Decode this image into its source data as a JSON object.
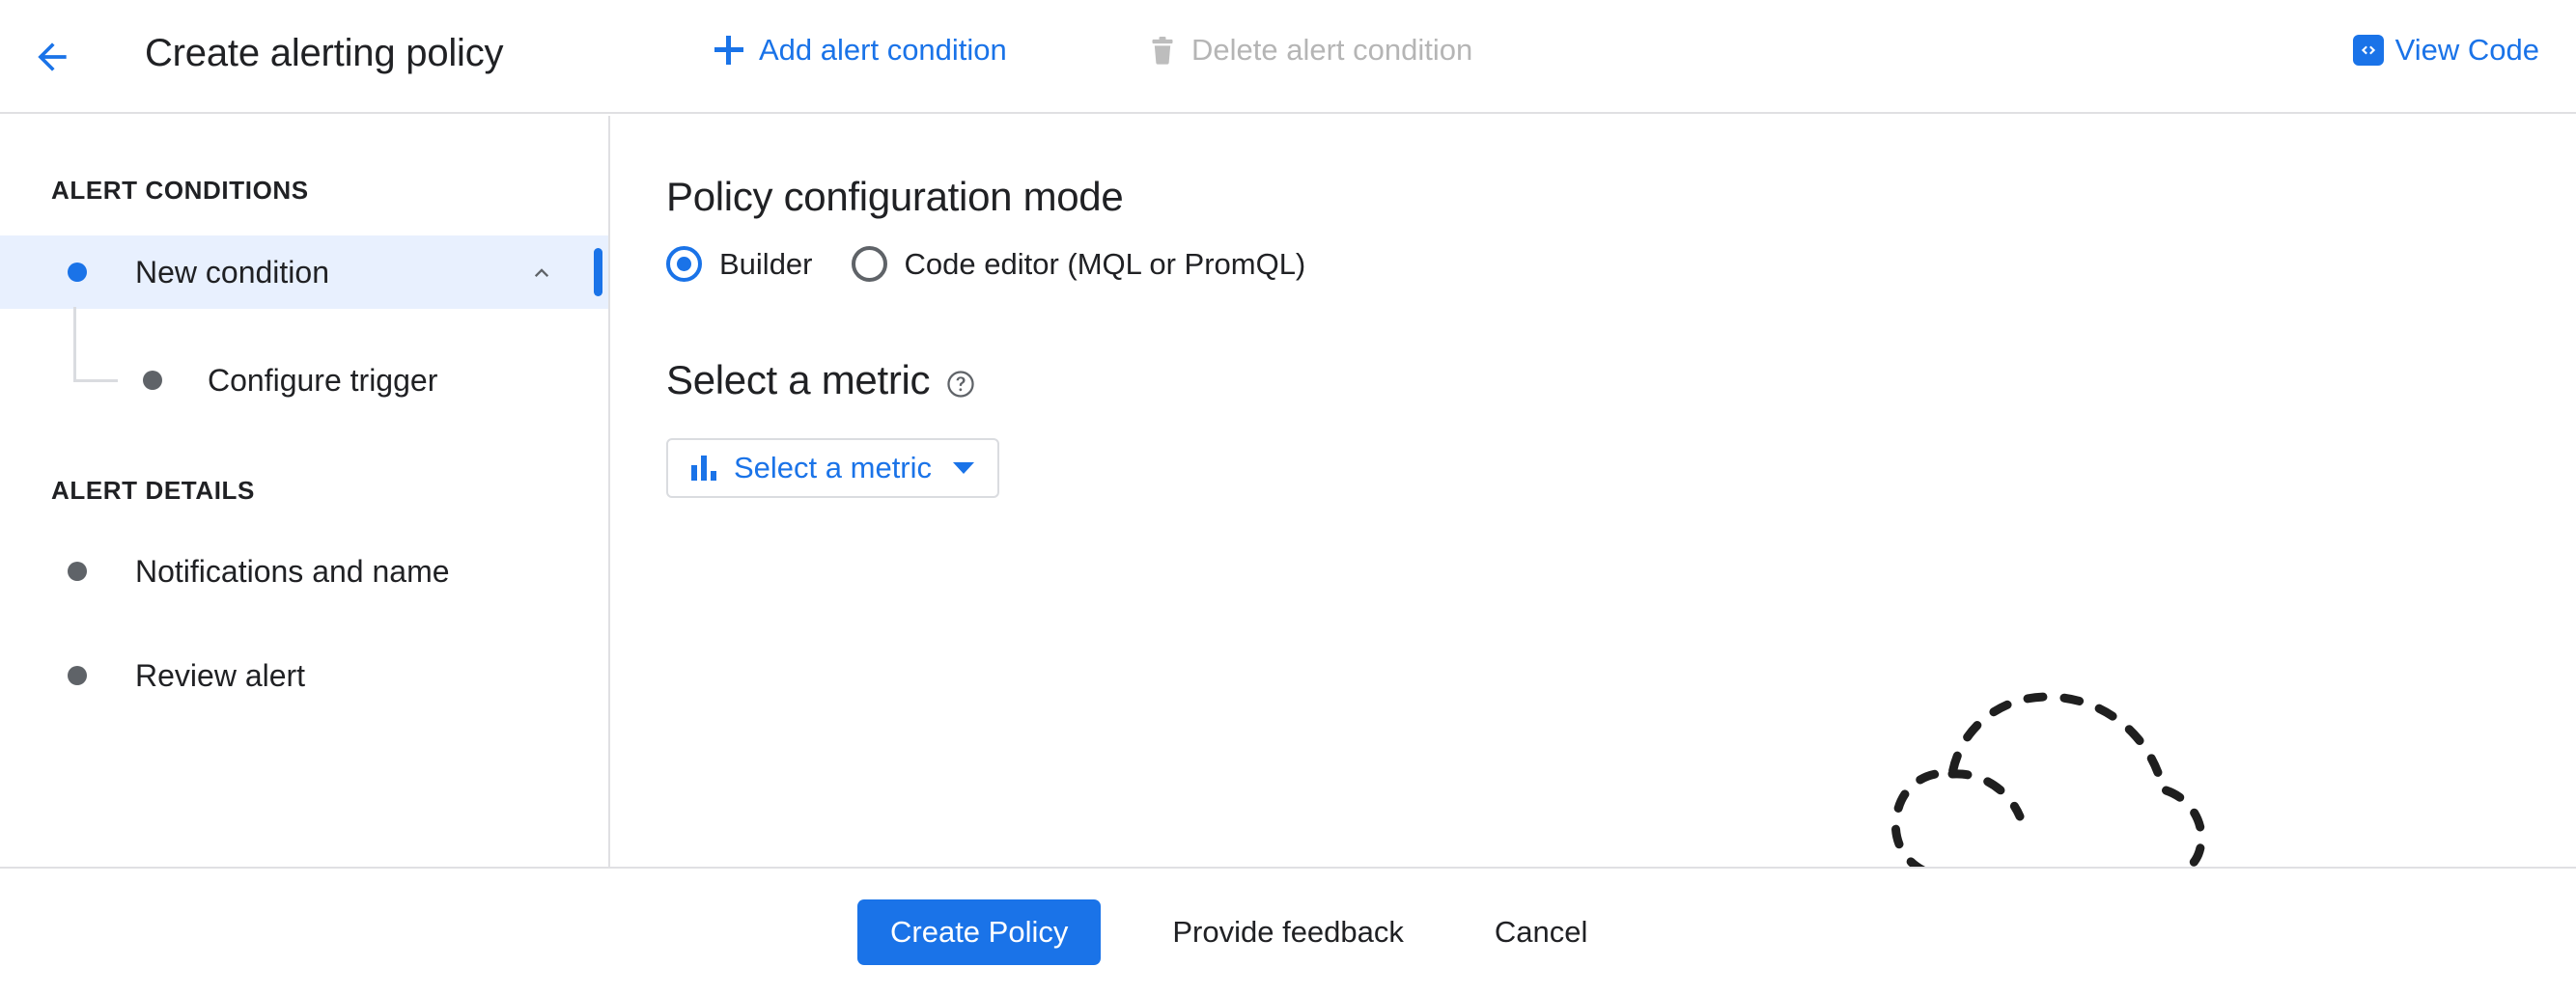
{
  "header": {
    "back_icon": "arrow-left-icon",
    "title": "Create alerting policy",
    "add_condition_label": "Add alert condition",
    "add_condition_icon": "plus-icon",
    "delete_condition_label": "Delete alert condition",
    "delete_condition_icon": "trash-icon",
    "view_code_label": "View Code",
    "view_code_icon": "code-brackets-icon",
    "accent_color": "#1a73e8",
    "disabled_color": "#b5b5b5"
  },
  "sidebar": {
    "groups": [
      {
        "label": "ALERT CONDITIONS"
      },
      {
        "label": "ALERT DETAILS"
      }
    ],
    "items": [
      {
        "label": "New condition",
        "state": "selected",
        "bullet": "blue-dot-icon",
        "trailing_icon": "chevron-up-icon"
      },
      {
        "label": "Configure trigger",
        "state": "child",
        "bullet": "grey-dot-icon"
      },
      {
        "label": "Notifications and name",
        "state": "default",
        "bullet": "grey-dot-icon"
      },
      {
        "label": "Review alert",
        "state": "default",
        "bullet": "grey-dot-icon"
      }
    ],
    "selected_background": "#e8f0fe",
    "indicator_color": "#1a73e8"
  },
  "main": {
    "config_mode": {
      "title": "Policy configuration mode",
      "options": [
        {
          "label": "Builder",
          "selected": true
        },
        {
          "label": "Code editor (MQL or PromQL)",
          "selected": false
        }
      ]
    },
    "metric": {
      "title": "Select a metric",
      "help_icon": "help-circle-icon",
      "button_label": "Select a metric",
      "button_icon": "bar-chart-icon",
      "caret_icon": "caret-down-icon"
    },
    "illustration": "dashed-cloud-icon"
  },
  "footer": {
    "primary_label": "Create Policy",
    "feedback_label": "Provide feedback",
    "cancel_label": "Cancel",
    "primary_color": "#1a73e8"
  }
}
